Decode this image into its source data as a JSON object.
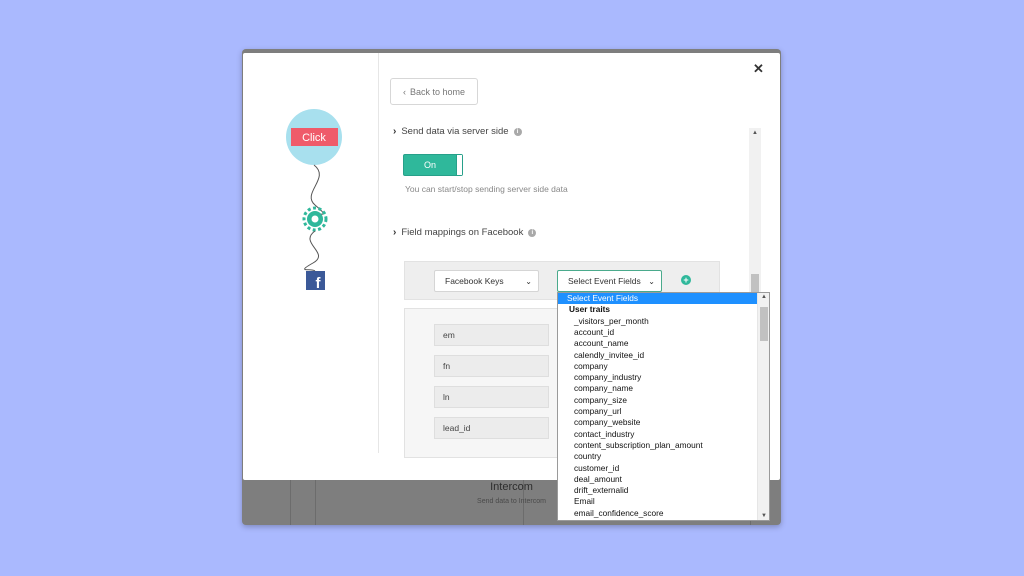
{
  "background_modal": {
    "title": "Intercom",
    "subtitle": "Send data to Intercom"
  },
  "flow": {
    "click_label": "Click",
    "nodes": [
      "click-node",
      "gear-node",
      "facebook-node"
    ],
    "colors": {
      "bubble": "#a8e0ee",
      "click": "#ef5b6a",
      "gear": "#2fb89b",
      "facebook": "#3b5998"
    }
  },
  "nav": {
    "back_label": "Back to home"
  },
  "server_side": {
    "heading": "Send data via server side",
    "toggle_label": "On",
    "help_text": "You can start/stop sending server side data"
  },
  "mappings": {
    "heading": "Field mappings on Facebook",
    "facebook_keys_select": "Facebook Keys",
    "event_fields_select": "Select Event Fields",
    "fields": [
      "em",
      "fn",
      "ln",
      "lead_id"
    ]
  },
  "dropdown": {
    "selected": "Select Event Fields",
    "group": "User traits",
    "options": [
      "_visitors_per_month",
      "account_id",
      "account_name",
      "calendly_invitee_id",
      "company",
      "company_industry",
      "company_name",
      "company_size",
      "company_url",
      "company_website",
      "contact_industry",
      "content_subscription_plan_amount",
      "country",
      "customer_id",
      "deal_amount",
      "drift_externalid",
      "Email",
      "email_confidence_score"
    ]
  },
  "colors": {
    "accent": "#2fb89b",
    "selection": "#1e90ff",
    "page_bg": "#aab9fe"
  }
}
